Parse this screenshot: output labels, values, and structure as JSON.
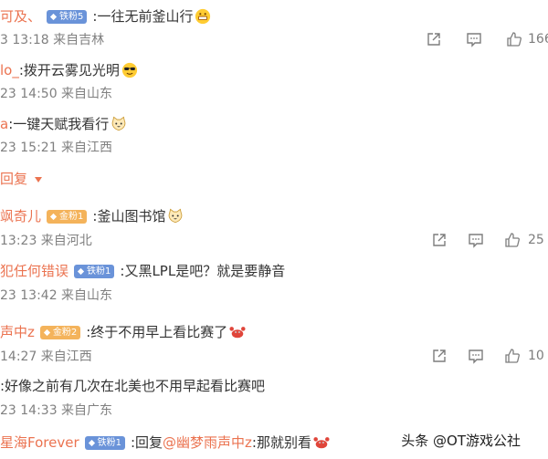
{
  "comments": [
    {
      "user": "可及、",
      "badge": "铁粉5",
      "text": ":一往无前釜山行",
      "meta": "3 13:18 来自吉林"
    },
    {
      "user": "lo_",
      "text": ":拨开云雾见光明",
      "meta": "23 14:50 来自山东"
    },
    {
      "user": "a",
      "text": ":一键天赋我看行",
      "meta": "23 15:21 来自江西"
    },
    {
      "more_label": "回复"
    },
    {
      "user": "飒奇儿",
      "badge": "金粉1",
      "text": ":釜山图书馆",
      "meta": "13:23 来自河北"
    },
    {
      "user": "犯任何错误",
      "badge": "铁粉1",
      "text": ":又黑LPL是吧？就是要静音",
      "meta": "23 13:42 来自山东"
    },
    {
      "user": "声中z",
      "badge": "金粉2",
      "text": ":终于不用早上看比赛了",
      "meta": "14:27 来自江西"
    },
    {
      "text": ":好像之前有几次在北美也不用早起看比赛吧",
      "meta": "23 14:33 来自广东"
    },
    {
      "user": "星海Forever",
      "badge": "铁粉1",
      "text_prefix": ":回复",
      "mention": "@幽梦雨声中z",
      "text_suffix": ":那就别看"
    }
  ],
  "actions": [
    {
      "like_count": "166"
    },
    {
      "like_count": "25"
    },
    {
      "like_count": "10"
    }
  ],
  "watermark": "头条 @OT游戏公社",
  "colors": {
    "username": "#eb7350",
    "fan_badge": "#6a93d9",
    "gold_badge": "#f4b35b",
    "meta": "#808080"
  }
}
